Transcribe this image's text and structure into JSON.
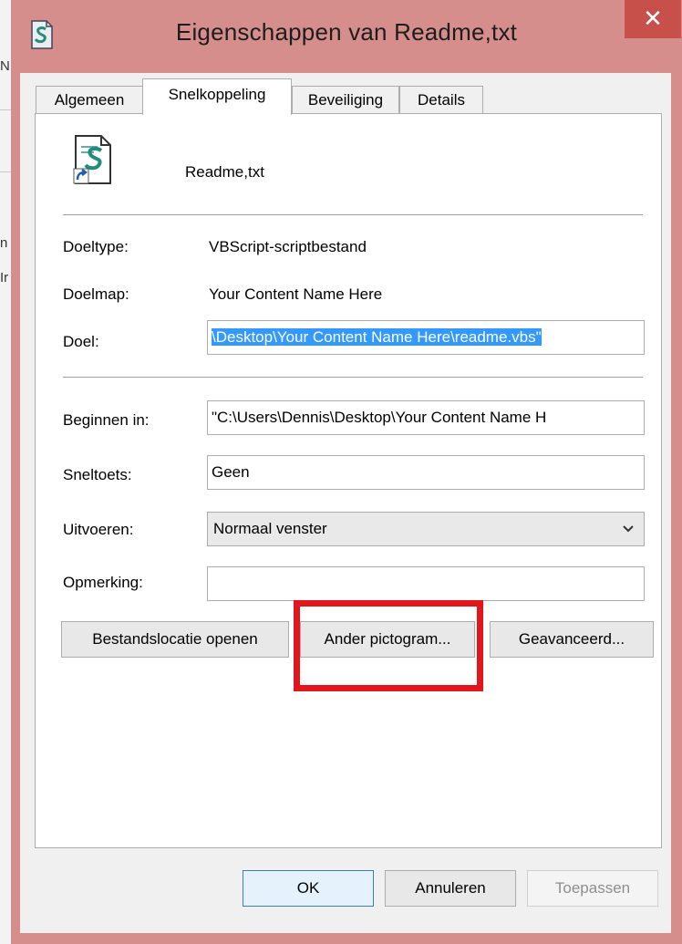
{
  "window": {
    "title": "Eigenschappen van Readme,txt",
    "close_glyph": "✕",
    "accent_frame": "#d58e8c",
    "close_color": "#c7504a"
  },
  "background_window": {
    "fragments": [
      "N",
      "n",
      "Ir"
    ]
  },
  "tabs": [
    {
      "label": "Algemeen",
      "active": false
    },
    {
      "label": "Snelkoppeling",
      "active": true
    },
    {
      "label": "Beveiliging",
      "active": false
    },
    {
      "label": "Details",
      "active": false
    }
  ],
  "file": {
    "icon": "vbscript-shortcut-icon",
    "name": "Readme,txt"
  },
  "properties": {
    "target_type_label": "Doeltype:",
    "target_type_value": "VBScript-scriptbestand",
    "target_location_label": "Doelmap:",
    "target_location_value": "Your Content Name Here",
    "target_label": "Doel:",
    "target_value": "\\Desktop\\Your Content Name Here\\readme.vbs\"",
    "start_in_label": "Beginnen in:",
    "start_in_value": "\"C:\\Users\\Dennis\\Desktop\\Your Content Name H",
    "shortcut_key_label": "Sneltoets:",
    "shortcut_key_value": "Geen",
    "run_label": "Uitvoeren:",
    "run_value": "Normaal venster",
    "comment_label": "Opmerking:",
    "comment_value": ""
  },
  "actions": {
    "open_location": "Bestandslocatie openen",
    "change_icon": "Ander pictogram...",
    "advanced": "Geavanceerd..."
  },
  "footer": {
    "ok": "OK",
    "cancel": "Annuleren",
    "apply": "Toepassen"
  },
  "highlight": {
    "target": "change-icon-button",
    "color": "#e2171e"
  }
}
